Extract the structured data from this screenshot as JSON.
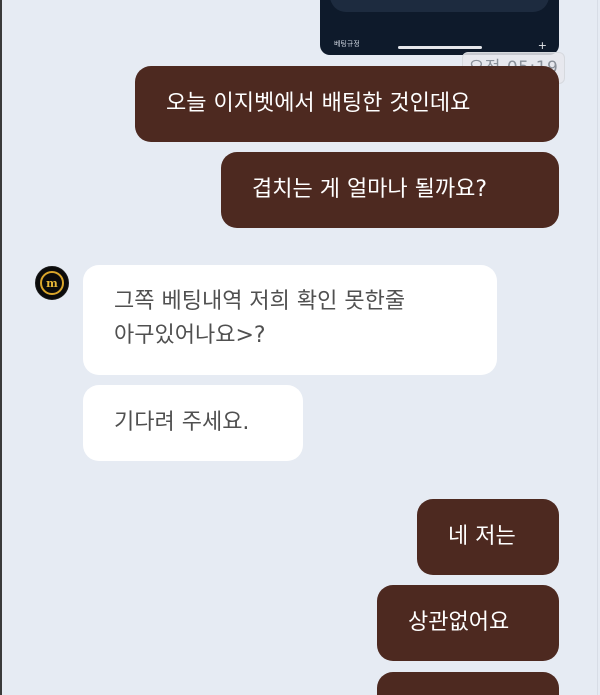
{
  "thumbnail": {
    "label": "베팅규정",
    "plus": "+"
  },
  "time_badge": "오전 05:19",
  "messages": {
    "out_1": "오늘 이지벳에서 배팅한 것인데요",
    "out_2": "겹치는 게 얼마나 될까요?",
    "in_1_line1": "그쪽 베팅내역 저희 확인 못한줄",
    "in_1_line2": "아구있어나요>?",
    "in_2": "기다려 주세요.",
    "out_3": "네 저는",
    "out_4": "상관없어요"
  },
  "avatar": {
    "letter": "m",
    "icon": "brand-logo-icon"
  },
  "colors": {
    "background": "#e6ebf3",
    "outgoing_bubble": "#4d2920",
    "incoming_bubble": "#ffffff",
    "avatar_gold": "#d9a52a"
  }
}
